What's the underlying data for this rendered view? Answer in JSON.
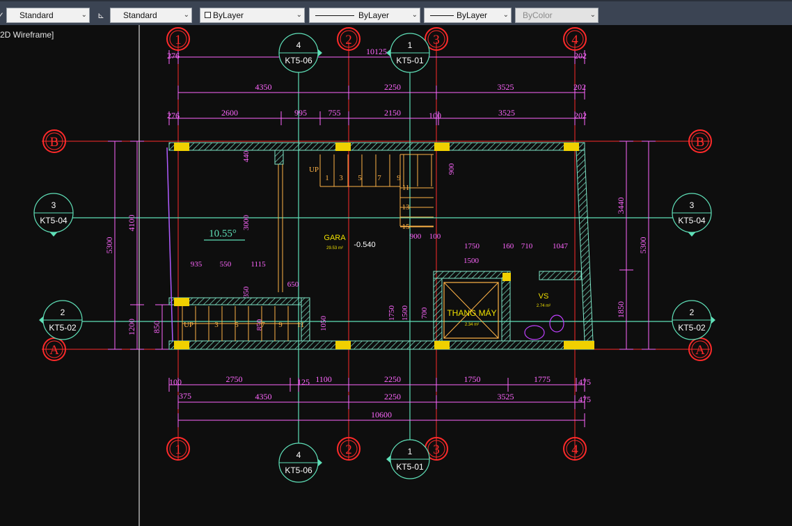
{
  "toolbar": {
    "text_style": "Standard",
    "dim_style": "Standard",
    "color": "ByLayer",
    "linetype": "ByLayer",
    "lineweight": "ByLayer",
    "plot_style": "ByColor"
  },
  "viewport": {
    "label": "2D Wireframe]"
  },
  "drawing": {
    "grid_numbers": [
      "1",
      "2",
      "3",
      "4"
    ],
    "grid_letters": [
      "B",
      "A"
    ],
    "section_markers": [
      {
        "num": "4",
        "code": "KT5-06"
      },
      {
        "num": "1",
        "code": "KT5-01"
      },
      {
        "num": "3",
        "code": "KT5-04"
      },
      {
        "num": "2",
        "code": "KT5-02"
      }
    ],
    "dims_top_overall": [
      "276",
      "10125",
      "202"
    ],
    "dims_top_axes": [
      "4350",
      "2250",
      "3525",
      "202"
    ],
    "dims_top_detail": [
      "276",
      "2600",
      "995",
      "755",
      "2150",
      "100",
      "3525",
      "202"
    ],
    "dims_bottom_detail": [
      "100",
      "2750",
      "125",
      "1100",
      "2250",
      "1750",
      "1775",
      "475"
    ],
    "dims_bottom_axes": [
      "375",
      "4350",
      "2250",
      "3525",
      "475"
    ],
    "dims_bottom_overall": "10600",
    "dims_left": [
      "5300",
      "4100",
      "1200",
      "850"
    ],
    "dims_right": [
      "3440",
      "5300",
      "1850"
    ],
    "dims_inner": [
      "440",
      "900",
      "3000",
      "900",
      "100",
      "1750",
      "160",
      "710",
      "1047",
      "1500",
      "935",
      "550",
      "1115",
      "350",
      "650",
      "1750",
      "1500",
      "700",
      "850",
      "1050"
    ],
    "stair_upper": [
      "UP",
      "1",
      "3",
      "5",
      "7",
      "9",
      "11",
      "13",
      "15"
    ],
    "stair_lower": [
      "UP",
      "3",
      "5",
      "7",
      "9",
      "11"
    ],
    "angle_label": "10.55°",
    "room_gara": "GARA",
    "room_gara_area": "29.53 m²",
    "level_label": "-0.540",
    "room_elevator": "THANG MÁY",
    "room_elevator_area": "2.34 m²",
    "room_wc": "VS",
    "room_wc_area": "2.74 m²",
    "colors": {
      "background": "#0e0e0e",
      "grid_line": "#ff2a2a",
      "section_line": "#5fe0b8",
      "dimension": "#ff66ff",
      "wall": "#7ee6c8",
      "column": "#f0d000"
    }
  }
}
